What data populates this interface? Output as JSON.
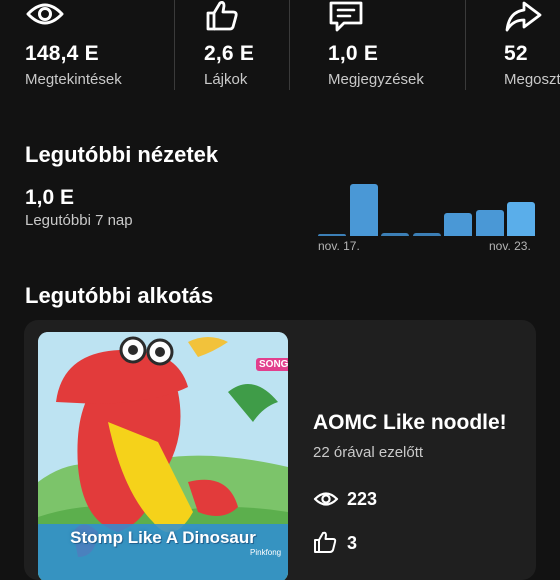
{
  "stats": [
    {
      "icon": "eye-icon",
      "value": "148,4 E",
      "label": "Megtekintések"
    },
    {
      "icon": "thumbs-up-icon",
      "value": "2,6 E",
      "label": "Lájkok"
    },
    {
      "icon": "comment-icon",
      "value": "1,0 E",
      "label": "Megjegyzések"
    },
    {
      "icon": "share-icon",
      "value": "52",
      "label": "Megoszt"
    }
  ],
  "recent_views": {
    "title": "Legutóbbi nézetek",
    "value": "1,0 E",
    "period": "Legutóbbi 7 nap",
    "chart_data": {
      "type": "bar",
      "categories": [
        "",
        "",
        "",
        "",
        "",
        "",
        ""
      ],
      "values": [
        0.04,
        1.0,
        0.06,
        0.06,
        0.45,
        0.5,
        0.66
      ],
      "tick_labels": [
        "nov. 17.",
        "nov. 23."
      ],
      "grid": false,
      "colors": {
        "bar": "#4a98d6",
        "bar_high": "#5aaeea",
        "bar_low": "#3c7fb6"
      }
    }
  },
  "recent_creation": {
    "title": "Legutóbbi alkotás",
    "thumbnail": {
      "caption": "Stomp Like A Dinosaur",
      "brand": "SONGS",
      "tag": "Pinkfong"
    },
    "video_title": "AOMC Like noodle!",
    "time_ago": "22 órával ezelőtt",
    "views": "223",
    "likes": "3"
  },
  "colors": {
    "background": "#121212",
    "card": "#1f1f1f",
    "muted_text": "#c9c9c9",
    "accent": "#4a98d6"
  }
}
